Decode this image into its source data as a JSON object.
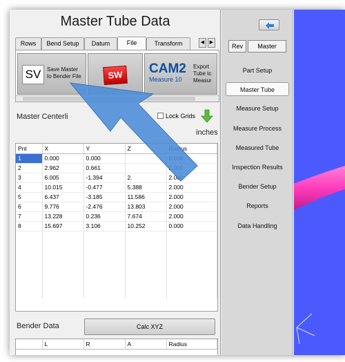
{
  "window": {
    "title": "Master Tube Data"
  },
  "tabs": [
    {
      "label": "Rows",
      "active": false
    },
    {
      "label": "Bend Setup",
      "active": false
    },
    {
      "label": "Datum",
      "active": false
    },
    {
      "label": "File",
      "active": true
    },
    {
      "label": "Transform",
      "active": false
    }
  ],
  "tab_scroll": {
    "left": "◀",
    "right": "▶"
  },
  "ribbon": {
    "save_master": {
      "icon_text": "SV",
      "label_line1": "Save Master",
      "label_line2": "to Bender File"
    },
    "solidworks": {
      "icon_text": "SW",
      "icon": "solidworks-icon"
    },
    "cam2": {
      "logo_big": "CAM2",
      "logo_small": "Measure 10",
      "label_line1": "Export M",
      "label_line2": "Tube to",
      "label_line3": "Measure"
    }
  },
  "master_centerline": {
    "title": "Master Centerli",
    "lock_grids_label": "Lock Grids",
    "lock_grids_checked": false,
    "units": "inches",
    "columns": [
      "Pnt",
      "X",
      "Y",
      "Z",
      "Radius"
    ],
    "rows": [
      [
        "1",
        "0.000",
        "0.000",
        "",
        "0.000"
      ],
      [
        "2",
        "2.962",
        "0.661",
        "",
        "2.000"
      ],
      [
        "3",
        "6.005",
        "-1.394",
        "2.",
        "2.000"
      ],
      [
        "4",
        "10.015",
        "-0.477",
        "5.388",
        "2.000"
      ],
      [
        "5",
        "6.437",
        "-3.185",
        "11.586",
        "2.000"
      ],
      [
        "6",
        "9.776",
        "-2.476",
        "13.803",
        "2.000"
      ],
      [
        "7",
        "13.228",
        "0.236",
        "7.674",
        "2.000"
      ],
      [
        "8",
        "15.697",
        "3.106",
        "10.252",
        "0.000"
      ]
    ]
  },
  "bender_data": {
    "title": "Bender Data",
    "calc_button": "Calc XYZ",
    "columns": [
      "",
      "L",
      "R",
      "A",
      "Radius"
    ]
  },
  "side_panel": {
    "rev_label": "Rev",
    "master_label": "Master",
    "nav": [
      {
        "label": "Part Setup",
        "active": false
      },
      {
        "label": "Master Tube",
        "active": true
      },
      {
        "label": "Measure Setup",
        "active": false
      },
      {
        "label": "Measure Process",
        "active": false
      },
      {
        "label": "Measured Tube",
        "active": false
      },
      {
        "label": "Inspection Results",
        "active": false
      },
      {
        "label": "Bender Setup",
        "active": false
      },
      {
        "label": "Reports",
        "active": false
      },
      {
        "label": "Data Handling",
        "active": false
      }
    ]
  },
  "colors": {
    "viewport_bg": "#4a5aff",
    "tube": "#ff3dbd",
    "selection": "#3a70d0",
    "cursor_arrow": "#4f8fd8",
    "accent_green": "#5bbd3a"
  }
}
